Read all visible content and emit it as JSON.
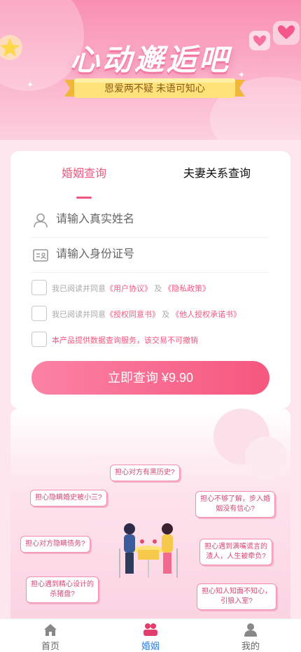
{
  "banner": {
    "title": "心动邂逅吧",
    "subtitle": "恩爱两不疑  未语可知心"
  },
  "tabs": {
    "active": "婚姻查询",
    "other": "夫妻关系查询"
  },
  "form": {
    "name_placeholder": "请输入真实姓名",
    "id_placeholder": "请输入身份证号",
    "agree1": {
      "prefix": "我已阅读并同意",
      "link1": "《用户协议》",
      "and": "及",
      "link2": "《隐私政策》"
    },
    "agree2": {
      "prefix": "我已阅读并同意",
      "link1": "《授权同意书》",
      "and": "及",
      "link2": "《他人授权承诺书》"
    },
    "notice": "本产品提供数据查询服务，该交易不可撤销",
    "submit_label": "立即查询 ¥9.90"
  },
  "worries": {
    "b1": "担心对方有黑历史?",
    "b2": "担心隐瞒婚史被小三?",
    "b3a": "担心不够了解，步入婚",
    "b3b": "姻没有信心?",
    "b4": "担心对方隐瞒债务?",
    "b5a": "担心遇到满嘴谎言的",
    "b5b": "渣人，人生被牵负?",
    "b6a": "担心遇到精心设计的",
    "b6b": "杀猪盘?",
    "b7a": "担心知人知面不知心，",
    "b7b": "引狼入室?"
  },
  "tabbar": {
    "home": "首页",
    "marriage": "婚姻",
    "mine": "我的"
  },
  "colors": {
    "accent": "#f2577f",
    "active_tab_bar": "#2f7de1"
  }
}
